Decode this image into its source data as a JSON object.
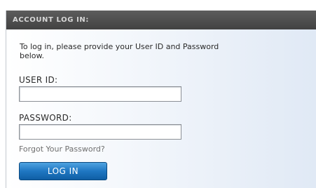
{
  "header": {
    "title": "ACCOUNT LOG IN:"
  },
  "intro": {
    "text": "To log in, please provide your User ID and Password below."
  },
  "user_id": {
    "label": "USER ID:",
    "value": "",
    "placeholder": ""
  },
  "password": {
    "label": "PASSWORD:",
    "value": "",
    "placeholder": ""
  },
  "forgot_link": "Forgot Your Password?",
  "login_button": {
    "label": "LOG IN"
  },
  "colors": {
    "header_bg": "#4a4a4a",
    "header_text": "#d6d6d6",
    "button_blue": "#1f77c2",
    "panel_gradient_end": "#e0e9f5"
  }
}
